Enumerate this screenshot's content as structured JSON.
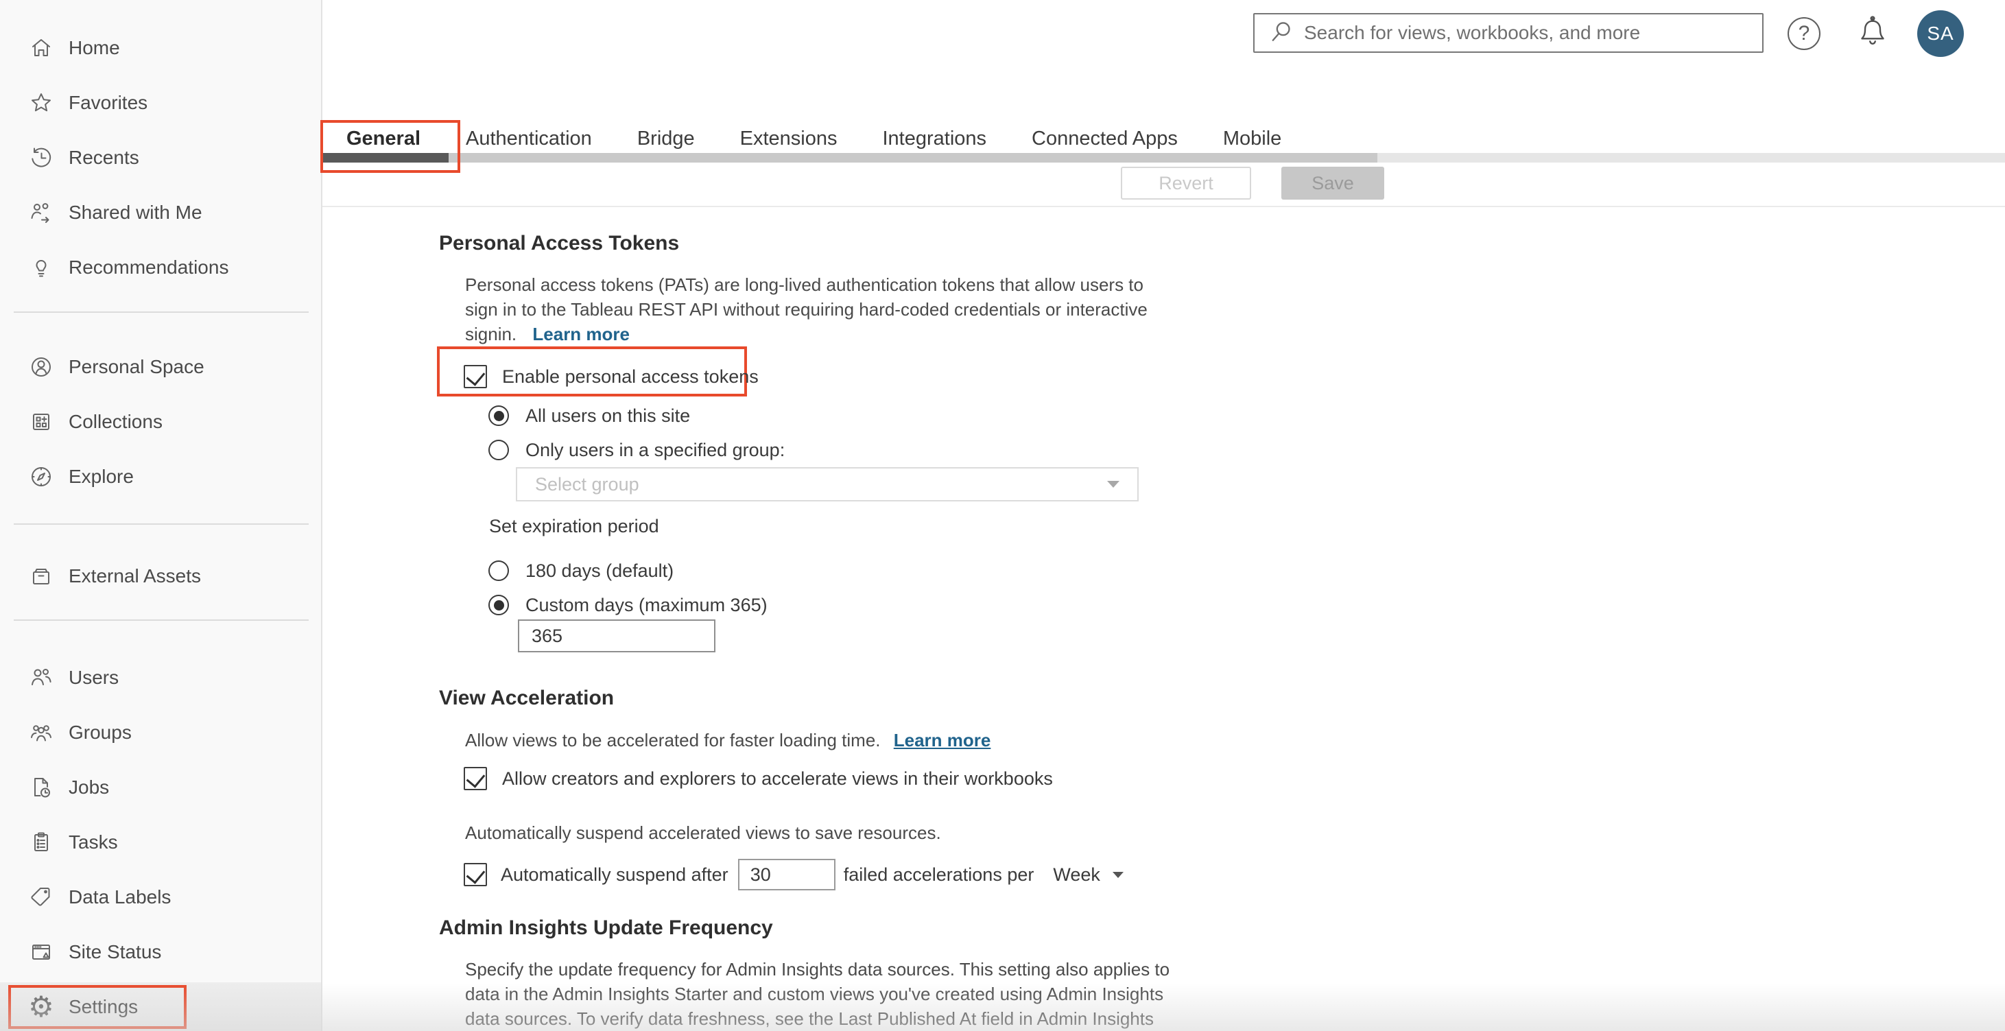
{
  "header": {
    "search_placeholder": "Search for views, workbooks, and more",
    "help_glyph": "?",
    "avatar_initials": "SA"
  },
  "sidebar": {
    "items": [
      {
        "label": "Home"
      },
      {
        "label": "Favorites"
      },
      {
        "label": "Recents"
      },
      {
        "label": "Shared with Me"
      },
      {
        "label": "Recommendations"
      },
      {
        "label": "Personal Space"
      },
      {
        "label": "Collections"
      },
      {
        "label": "Explore"
      },
      {
        "label": "External Assets"
      },
      {
        "label": "Users"
      },
      {
        "label": "Groups"
      },
      {
        "label": "Jobs"
      },
      {
        "label": "Tasks"
      },
      {
        "label": "Data Labels"
      },
      {
        "label": "Site Status"
      },
      {
        "label": "Settings"
      }
    ]
  },
  "tabs": {
    "items": [
      {
        "label": "General"
      },
      {
        "label": "Authentication"
      },
      {
        "label": "Bridge"
      },
      {
        "label": "Extensions"
      },
      {
        "label": "Integrations"
      },
      {
        "label": "Connected Apps"
      },
      {
        "label": "Mobile"
      }
    ],
    "active": "General"
  },
  "toolbar": {
    "revert_label": "Revert",
    "save_label": "Save"
  },
  "sections": {
    "pat": {
      "title": "Personal Access Tokens",
      "desc_line1": "Personal access tokens (PATs) are long-lived authentication tokens that allow users to",
      "desc_line2": "sign in to the Tableau REST API without requiring hard-coded credentials or interactive",
      "desc_line3": "signin.",
      "learn_more": "Learn more",
      "enable_label": "Enable personal access tokens",
      "radio_all_users": "All users on this site",
      "radio_group": "Only users in a specified group:",
      "group_placeholder": "Select group",
      "expiration_label": "Set expiration period",
      "radio_180": "180 days (default)",
      "radio_custom": "Custom days (maximum 365)",
      "custom_days_value": "365"
    },
    "view_accel": {
      "title": "View Acceleration",
      "desc": "Allow views to be accelerated for faster loading time.",
      "learn_more": "Learn more",
      "allow_label": "Allow creators and explorers to accelerate views in their workbooks",
      "suspend_desc": "Automatically suspend accelerated views to save resources.",
      "suspend_prefix": "Automatically suspend after",
      "suspend_value": "30",
      "suspend_suffix": "failed accelerations per",
      "suspend_period": "Week"
    },
    "admin_insights": {
      "title": "Admin Insights Update Frequency",
      "desc_line1": "Specify the update frequency for Admin Insights data sources. This setting also applies to",
      "desc_line2": "data in the Admin Insights Starter and custom views you've created using Admin Insights",
      "desc_line3": "data sources. To verify data freshness, see the Last Published At field in Admin Insights"
    }
  },
  "colors": {
    "annotation_red": "#e84a2c",
    "link_blue": "#20638c",
    "avatar_bg": "#35617f",
    "active_tab_indicator": "#595959"
  }
}
